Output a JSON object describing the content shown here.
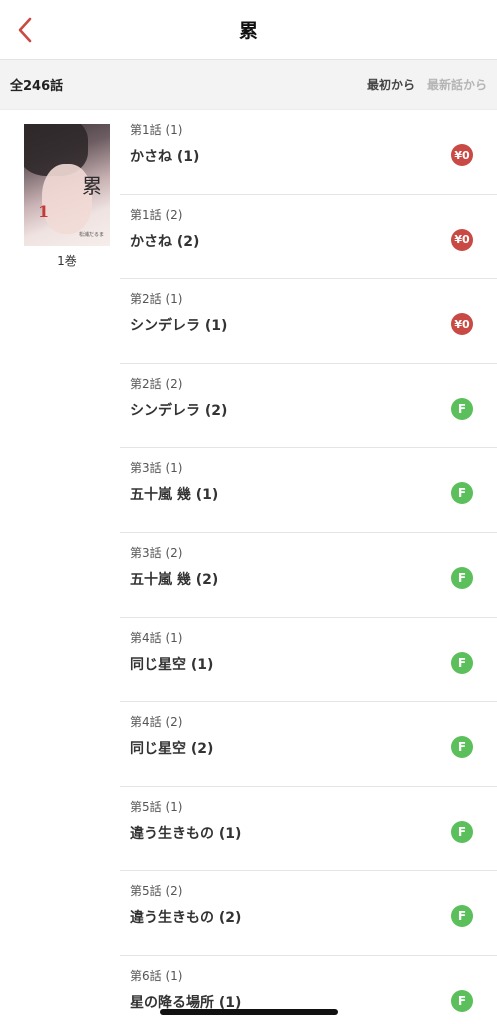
{
  "header": {
    "title": "累"
  },
  "subbar": {
    "total": "全246話",
    "sort_oldest": "最初から",
    "sort_newest": "最新話から"
  },
  "volume": {
    "label": "1巻",
    "cover_kanji": "累",
    "cover_num": "1",
    "cover_author": "松浦だるま"
  },
  "colors": {
    "accent": "#c94a44",
    "free": "#5bbf5b"
  },
  "episodes": [
    {
      "num": "第1話 (1)",
      "title": "かさね (1)",
      "badge": "¥0",
      "type": "paid"
    },
    {
      "num": "第1話 (2)",
      "title": "かさね (2)",
      "badge": "¥0",
      "type": "paid"
    },
    {
      "num": "第2話 (1)",
      "title": "シンデレラ (1)",
      "badge": "¥0",
      "type": "paid"
    },
    {
      "num": "第2話 (2)",
      "title": "シンデレラ (2)",
      "badge": "F",
      "type": "free"
    },
    {
      "num": "第3話 (1)",
      "title": "五十嵐 幾 (1)",
      "badge": "F",
      "type": "free"
    },
    {
      "num": "第3話 (2)",
      "title": "五十嵐 幾 (2)",
      "badge": "F",
      "type": "free"
    },
    {
      "num": "第4話 (1)",
      "title": "同じ星空 (1)",
      "badge": "F",
      "type": "free"
    },
    {
      "num": "第4話 (2)",
      "title": "同じ星空 (2)",
      "badge": "F",
      "type": "free"
    },
    {
      "num": "第5話 (1)",
      "title": "違う生きもの (1)",
      "badge": "F",
      "type": "free"
    },
    {
      "num": "第5話 (2)",
      "title": "違う生きもの (2)",
      "badge": "F",
      "type": "free"
    },
    {
      "num": "第6話 (1)",
      "title": "星の降る場所 (1)",
      "badge": "F",
      "type": "free"
    }
  ]
}
